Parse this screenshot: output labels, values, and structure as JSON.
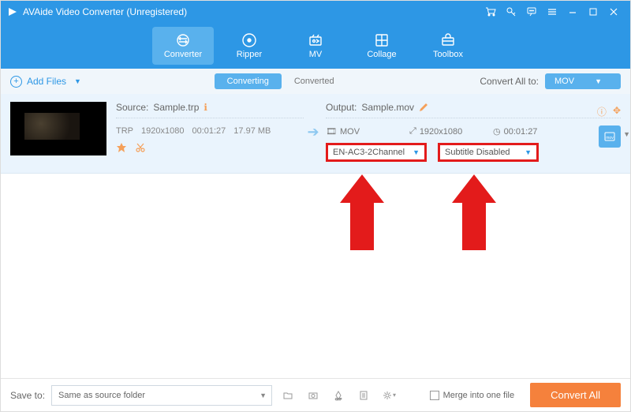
{
  "window": {
    "title": "AVAide Video Converter (Unregistered)"
  },
  "nav": {
    "items": [
      {
        "label": "Converter"
      },
      {
        "label": "Ripper"
      },
      {
        "label": "MV"
      },
      {
        "label": "Collage"
      },
      {
        "label": "Toolbox"
      }
    ]
  },
  "subbar": {
    "add_files": "Add Files",
    "tabs": {
      "converting": "Converting",
      "converted": "Converted"
    },
    "convert_all_label": "Convert All to:",
    "format": "MOV"
  },
  "item": {
    "source_label": "Source:",
    "source_name": "Sample.trp",
    "src_codec": "TRP",
    "src_res": "1920x1080",
    "src_dur": "00:01:27",
    "src_size": "17.97 MB",
    "output_label": "Output:",
    "output_name": "Sample.mov",
    "out_format": "MOV",
    "out_res": "1920x1080",
    "out_dur": "00:01:27",
    "audio_select": "EN-AC3-2Channel",
    "subtitle_select": "Subtitle Disabled"
  },
  "bottom": {
    "save_to_label": "Save to:",
    "folder": "Same as source folder",
    "merge_label": "Merge into one file",
    "convert_btn": "Convert All"
  },
  "colors": {
    "primary": "#2d97e5",
    "accent_orange": "#f5813c",
    "highlight_red": "#e31b1b"
  }
}
